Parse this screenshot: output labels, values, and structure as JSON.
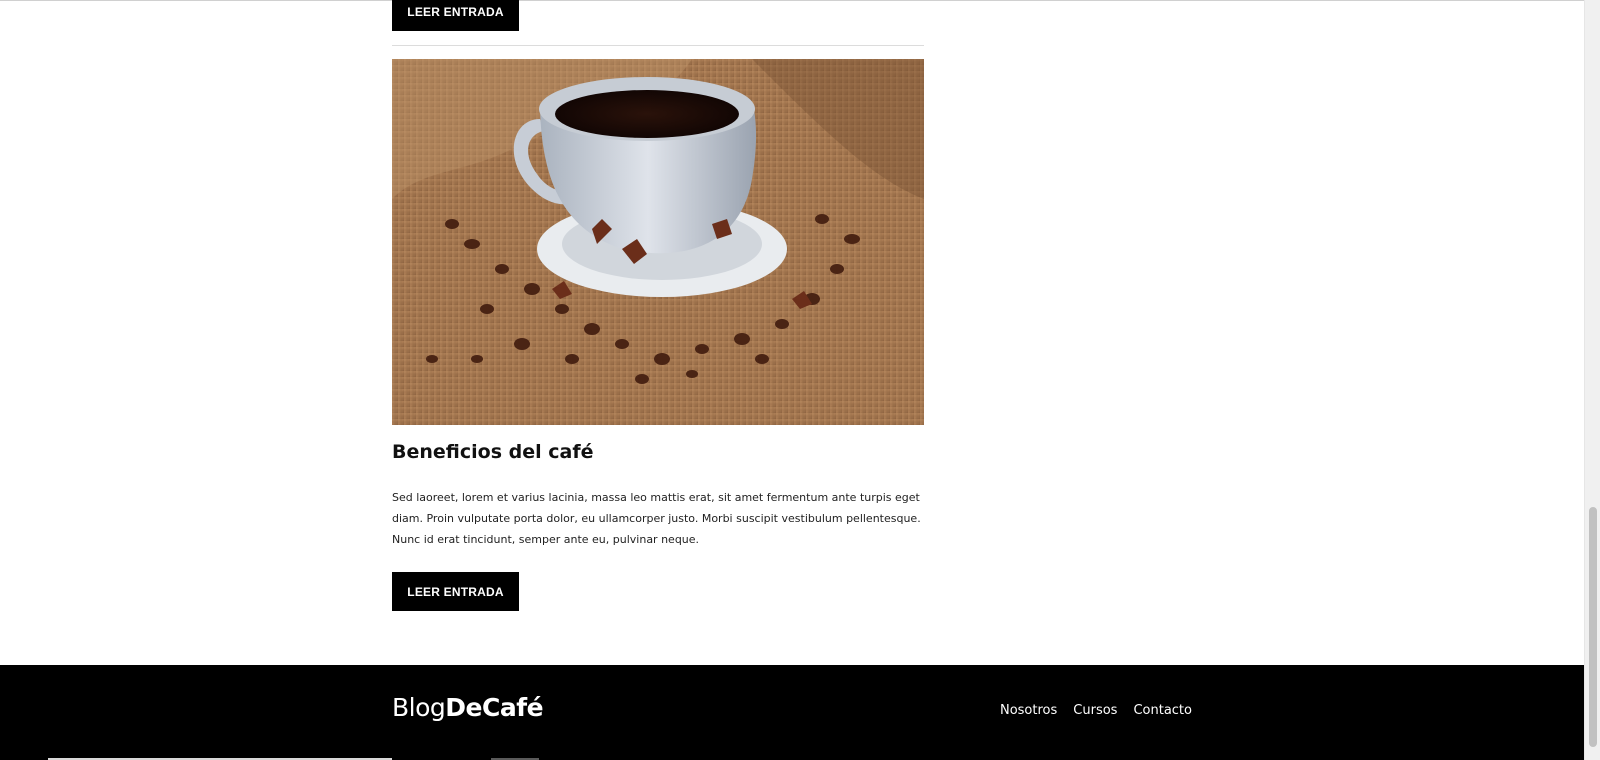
{
  "posts": {
    "previous_button_label": "LEER ENTRADA",
    "current": {
      "title": "Beneficios del café",
      "excerpt": "Sed laoreet, lorem et varius lacinia, massa leo mattis erat, sit amet fermentum ante turpis eget diam. Proin vulputate porta dolor, eu ullamcorper justo. Morbi suscipit vestibulum pellentesque. Nunc id erat tincidunt, semper ante eu, pulvinar neque.",
      "button_label": "LEER ENTRADA",
      "image_alt": "coffee-cup-with-beans-on-burlap"
    }
  },
  "footer": {
    "logo_light": "Blog",
    "logo_bold": "DeCafé",
    "nav": [
      "Nosotros",
      "Cursos",
      "Contacto"
    ]
  },
  "colors": {
    "footer_bg": "#000000",
    "button_bg": "#000000",
    "button_text": "#ffffff"
  }
}
